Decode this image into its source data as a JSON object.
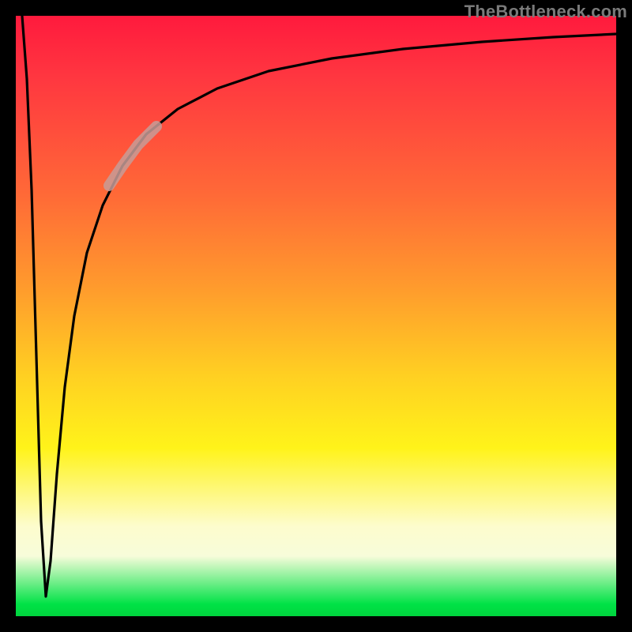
{
  "watermark": {
    "text": "TheBottleneck.com"
  },
  "chart_data": {
    "type": "line",
    "title": "",
    "xlabel": "",
    "ylabel": "",
    "xlim": [
      0,
      100
    ],
    "ylim": [
      0,
      100
    ],
    "grid": false,
    "legend": false,
    "background_gradient": {
      "direction": "vertical_top_to_bottom",
      "stops": [
        {
          "pct": 0,
          "color": "#ff1a3d"
        },
        {
          "pct": 30,
          "color": "#ff6a37"
        },
        {
          "pct": 60,
          "color": "#ffd022"
        },
        {
          "pct": 85,
          "color": "#fdfccd"
        },
        {
          "pct": 98,
          "color": "#00e246"
        }
      ]
    },
    "series": [
      {
        "name": "bottleneck-curve",
        "color": "#000000",
        "x": [
          0,
          1,
          2,
          3,
          4,
          5,
          6,
          8,
          10,
          12,
          15,
          18,
          22,
          27,
          33,
          40,
          50,
          60,
          72,
          85,
          100
        ],
        "y": [
          100,
          70,
          40,
          15,
          2,
          10,
          30,
          50,
          62,
          70,
          76,
          80,
          84,
          87,
          89.5,
          91.5,
          93.3,
          94.5,
          95.5,
          96.3,
          97
        ]
      },
      {
        "name": "highlight-segment",
        "color": "#c79c98",
        "note": "light marker band over curve between roughly x=15 and x=22",
        "x": [
          15,
          17,
          19,
          22
        ],
        "y": [
          76,
          78.2,
          80,
          84
        ]
      }
    ]
  }
}
